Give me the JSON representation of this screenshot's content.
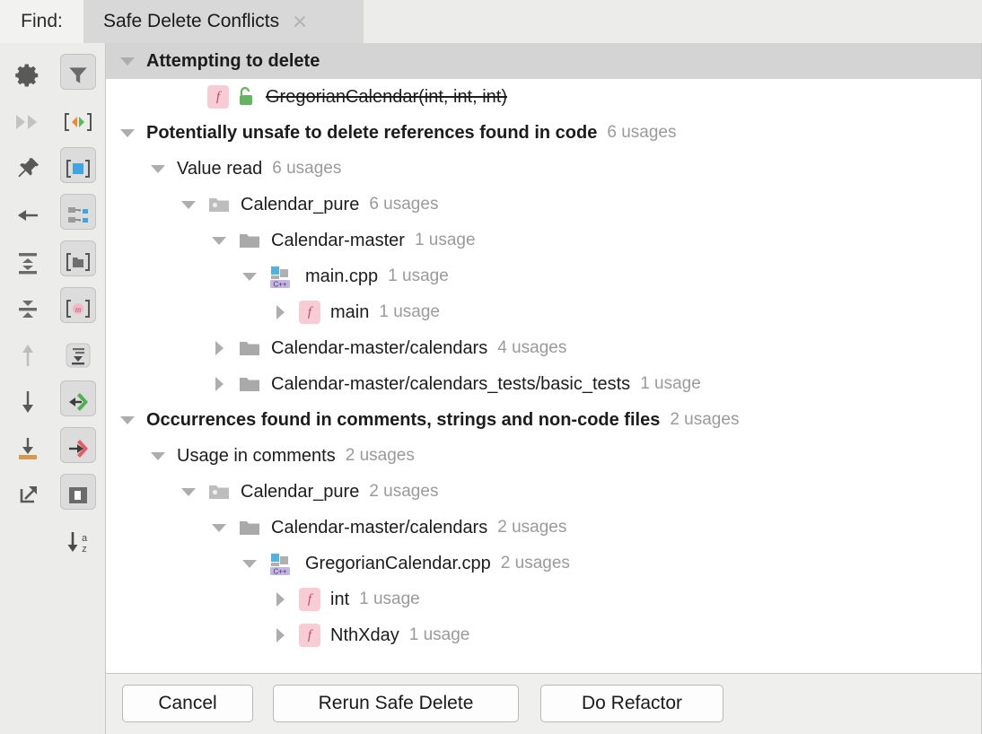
{
  "window": {
    "find_label": "Find:",
    "tab_title": "Safe Delete Conflicts",
    "close_icon": "close-icon"
  },
  "toolbar": {
    "left_column": [
      {
        "name": "settings-icon",
        "label": "Settings",
        "toggled": false,
        "enabled": true
      },
      {
        "name": "expand-all-fast-forward-icon",
        "label": "Skip Results Tab With One Usage",
        "toggled": false,
        "enabled": false
      },
      {
        "name": "pin-icon",
        "label": "Pin Tab",
        "toggled": false,
        "enabled": true
      },
      {
        "name": "arrow-left-icon",
        "label": "Previous Occurrence",
        "toggled": false,
        "enabled": true
      },
      {
        "name": "expand-all-icon",
        "label": "Expand All",
        "toggled": false,
        "enabled": true
      },
      {
        "name": "collapse-all-icon",
        "label": "Collapse All",
        "toggled": false,
        "enabled": true
      },
      {
        "name": "arrow-up-icon",
        "label": "Up",
        "toggled": false,
        "enabled": false
      },
      {
        "name": "arrow-down-icon",
        "label": "Down",
        "toggled": false,
        "enabled": true
      },
      {
        "name": "export-to-file-icon",
        "label": "Export to Text File",
        "toggled": false,
        "enabled": true
      },
      {
        "name": "open-in-new-window-icon",
        "label": "Open in New Window",
        "toggled": false,
        "enabled": true
      }
    ],
    "right_column": [
      {
        "name": "filter-icon",
        "label": "Filter",
        "toggled": true,
        "enabled": true
      },
      {
        "name": "show-read-write-access-icon",
        "label": "Show Read/Write Access",
        "toggled": false,
        "enabled": true
      },
      {
        "name": "group-by-module-icon",
        "label": "Group by Module",
        "toggled": true,
        "enabled": true
      },
      {
        "name": "group-by-structure-icon",
        "label": "Group by File Structure",
        "toggled": true,
        "enabled": true
      },
      {
        "name": "group-by-directory-icon",
        "label": "Group by Directory",
        "toggled": true,
        "enabled": true
      },
      {
        "name": "group-by-member-icon",
        "label": "Group by Member",
        "toggled": true,
        "enabled": true
      },
      {
        "name": "merge-usages-icon",
        "label": "Merge Usages",
        "toggled": true,
        "enabled": true
      },
      {
        "name": "show-import-statements-icon",
        "label": "Show Import Statements",
        "toggled": true,
        "enabled": true
      },
      {
        "name": "show-write-access-icon",
        "label": "Show Write Access",
        "toggled": true,
        "enabled": true
      },
      {
        "name": "preview-usages-icon",
        "label": "Preview Usages",
        "toggled": true,
        "enabled": true
      },
      {
        "name": "sort-alphabetically-icon",
        "label": "Sort Alphabetically",
        "toggled": false,
        "enabled": true
      }
    ]
  },
  "tree": [
    {
      "id": "attempting-to-delete",
      "indent": 0,
      "twisty": "open",
      "bold": true,
      "selected": true,
      "icon": null,
      "label": "Attempting to delete",
      "count": ""
    },
    {
      "id": "gregorian-calendar-ctor",
      "indent": 2,
      "twisty": "none",
      "bold": false,
      "selected": false,
      "icon": "function-lock",
      "label": "GregorianCalendar(int, int, int)",
      "count": "",
      "strike": true
    },
    {
      "id": "potentially-unsafe",
      "indent": 0,
      "twisty": "open",
      "bold": true,
      "selected": false,
      "icon": null,
      "label": "Potentially unsafe to delete references found in code",
      "count": "6 usages"
    },
    {
      "id": "value-read",
      "indent": 1,
      "twisty": "open",
      "bold": false,
      "selected": false,
      "icon": null,
      "label": "Value read",
      "count": "6 usages"
    },
    {
      "id": "calendar-pure-module-1",
      "indent": 2,
      "twisty": "open",
      "bold": false,
      "selected": false,
      "icon": "module",
      "label": "Calendar_pure",
      "count": "6 usages"
    },
    {
      "id": "calendar-master-dir",
      "indent": 3,
      "twisty": "open",
      "bold": false,
      "selected": false,
      "icon": "folder",
      "label": "Calendar-master",
      "count": "1 usage"
    },
    {
      "id": "main-cpp-file",
      "indent": 4,
      "twisty": "open",
      "bold": false,
      "selected": false,
      "icon": "cpp",
      "label": "main.cpp",
      "count": "1 usage"
    },
    {
      "id": "main-function",
      "indent": 5,
      "twisty": "closed",
      "bold": false,
      "selected": false,
      "icon": "function",
      "label": "main",
      "count": "1 usage"
    },
    {
      "id": "calendars-dir",
      "indent": 3,
      "twisty": "closed",
      "bold": false,
      "selected": false,
      "icon": "folder",
      "label": "Calendar-master/calendars",
      "count": "4 usages"
    },
    {
      "id": "basic-tests-dir",
      "indent": 3,
      "twisty": "closed",
      "bold": false,
      "selected": false,
      "icon": "folder",
      "label": "Calendar-master/calendars_tests/basic_tests",
      "count": "1 usage"
    },
    {
      "id": "occurrences-in-comments",
      "indent": 0,
      "twisty": "open",
      "bold": true,
      "selected": false,
      "icon": null,
      "label": "Occurrences found in comments, strings and non-code files",
      "count": "2 usages"
    },
    {
      "id": "usage-in-comments",
      "indent": 1,
      "twisty": "open",
      "bold": false,
      "selected": false,
      "icon": null,
      "label": "Usage in comments",
      "count": "2 usages"
    },
    {
      "id": "calendar-pure-module-2",
      "indent": 2,
      "twisty": "open",
      "bold": false,
      "selected": false,
      "icon": "module",
      "label": "Calendar_pure",
      "count": "2 usages"
    },
    {
      "id": "calendars-dir-2",
      "indent": 3,
      "twisty": "open",
      "bold": false,
      "selected": false,
      "icon": "folder",
      "label": "Calendar-master/calendars",
      "count": "2 usages"
    },
    {
      "id": "gregoriancalendar-cpp-file",
      "indent": 4,
      "twisty": "open",
      "bold": false,
      "selected": false,
      "icon": "cpp",
      "label": "GregorianCalendar.cpp",
      "count": "2 usages"
    },
    {
      "id": "int-function",
      "indent": 5,
      "twisty": "closed",
      "bold": false,
      "selected": false,
      "icon": "function",
      "label": "int",
      "count": "1 usage"
    },
    {
      "id": "nthxday-function",
      "indent": 5,
      "twisty": "closed",
      "bold": false,
      "selected": false,
      "icon": "function",
      "label": "NthXday",
      "count": "1 usage"
    }
  ],
  "buttons": {
    "cancel": "Cancel",
    "rerun": "Rerun Safe Delete",
    "do_refactor": "Do Refactor"
  },
  "colors": {
    "selection": "#d4d4d4",
    "panel_bg": "#ffffff",
    "chrome_bg": "#ececeb",
    "tab_bg": "#d8d8d8",
    "count_text": "#9a9a9a",
    "function_badge": "#f7ccd4",
    "cpp_badge": "#c5b3e6",
    "folder": "#a8a8a8",
    "accent_blue": "#4fb3e0",
    "accent_green": "#62b862",
    "accent_red": "#e06c75",
    "accent_orange": "#f08b33"
  }
}
